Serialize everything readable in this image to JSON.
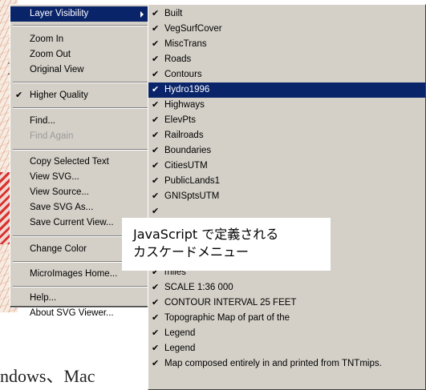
{
  "background": {
    "letter": "F",
    "bottom_text": "ndows、Mac"
  },
  "main_menu": {
    "items": [
      {
        "label": "Layer Visibility"
      },
      {
        "label": "Zoom In"
      },
      {
        "label": "Zoom Out"
      },
      {
        "label": "Original View"
      },
      {
        "label": "Higher Quality",
        "checked": true
      },
      {
        "label": "Find..."
      },
      {
        "label": "Find Again",
        "disabled": true
      },
      {
        "label": "Copy Selected Text"
      },
      {
        "label": "View SVG..."
      },
      {
        "label": "View Source..."
      },
      {
        "label": "Save SVG As..."
      },
      {
        "label": "Save Current View..."
      },
      {
        "label": "Change Color"
      },
      {
        "label": "MicroImages Home..."
      },
      {
        "label": "Help..."
      },
      {
        "label": "About SVG Viewer..."
      }
    ]
  },
  "submenu": {
    "items": [
      "Built",
      "VegSurfCover",
      "MiscTrans",
      "Roads",
      "Contours",
      "Hydro1996",
      "Highways",
      "ElevPts",
      "Railroads",
      "Boundaries",
      "CitiesUTM",
      "PublicLands1",
      "GNISptsUTM",
      "",
      "",
      "",
      "",
      "miles",
      "SCALE 1:36 000",
      "CONTOUR INTERVAL 25 FEET",
      "Topographic Map of part of the",
      "Legend",
      "Legend",
      "Map composed entirely in and printed from TNTmips."
    ],
    "selected": "Hydro1996"
  },
  "caption": {
    "line1": "JavaScript で定義される",
    "line2": "カスケードメニュー"
  },
  "colors": {
    "menu_bg": "#d4d0c8",
    "highlight": "#0a246a"
  }
}
